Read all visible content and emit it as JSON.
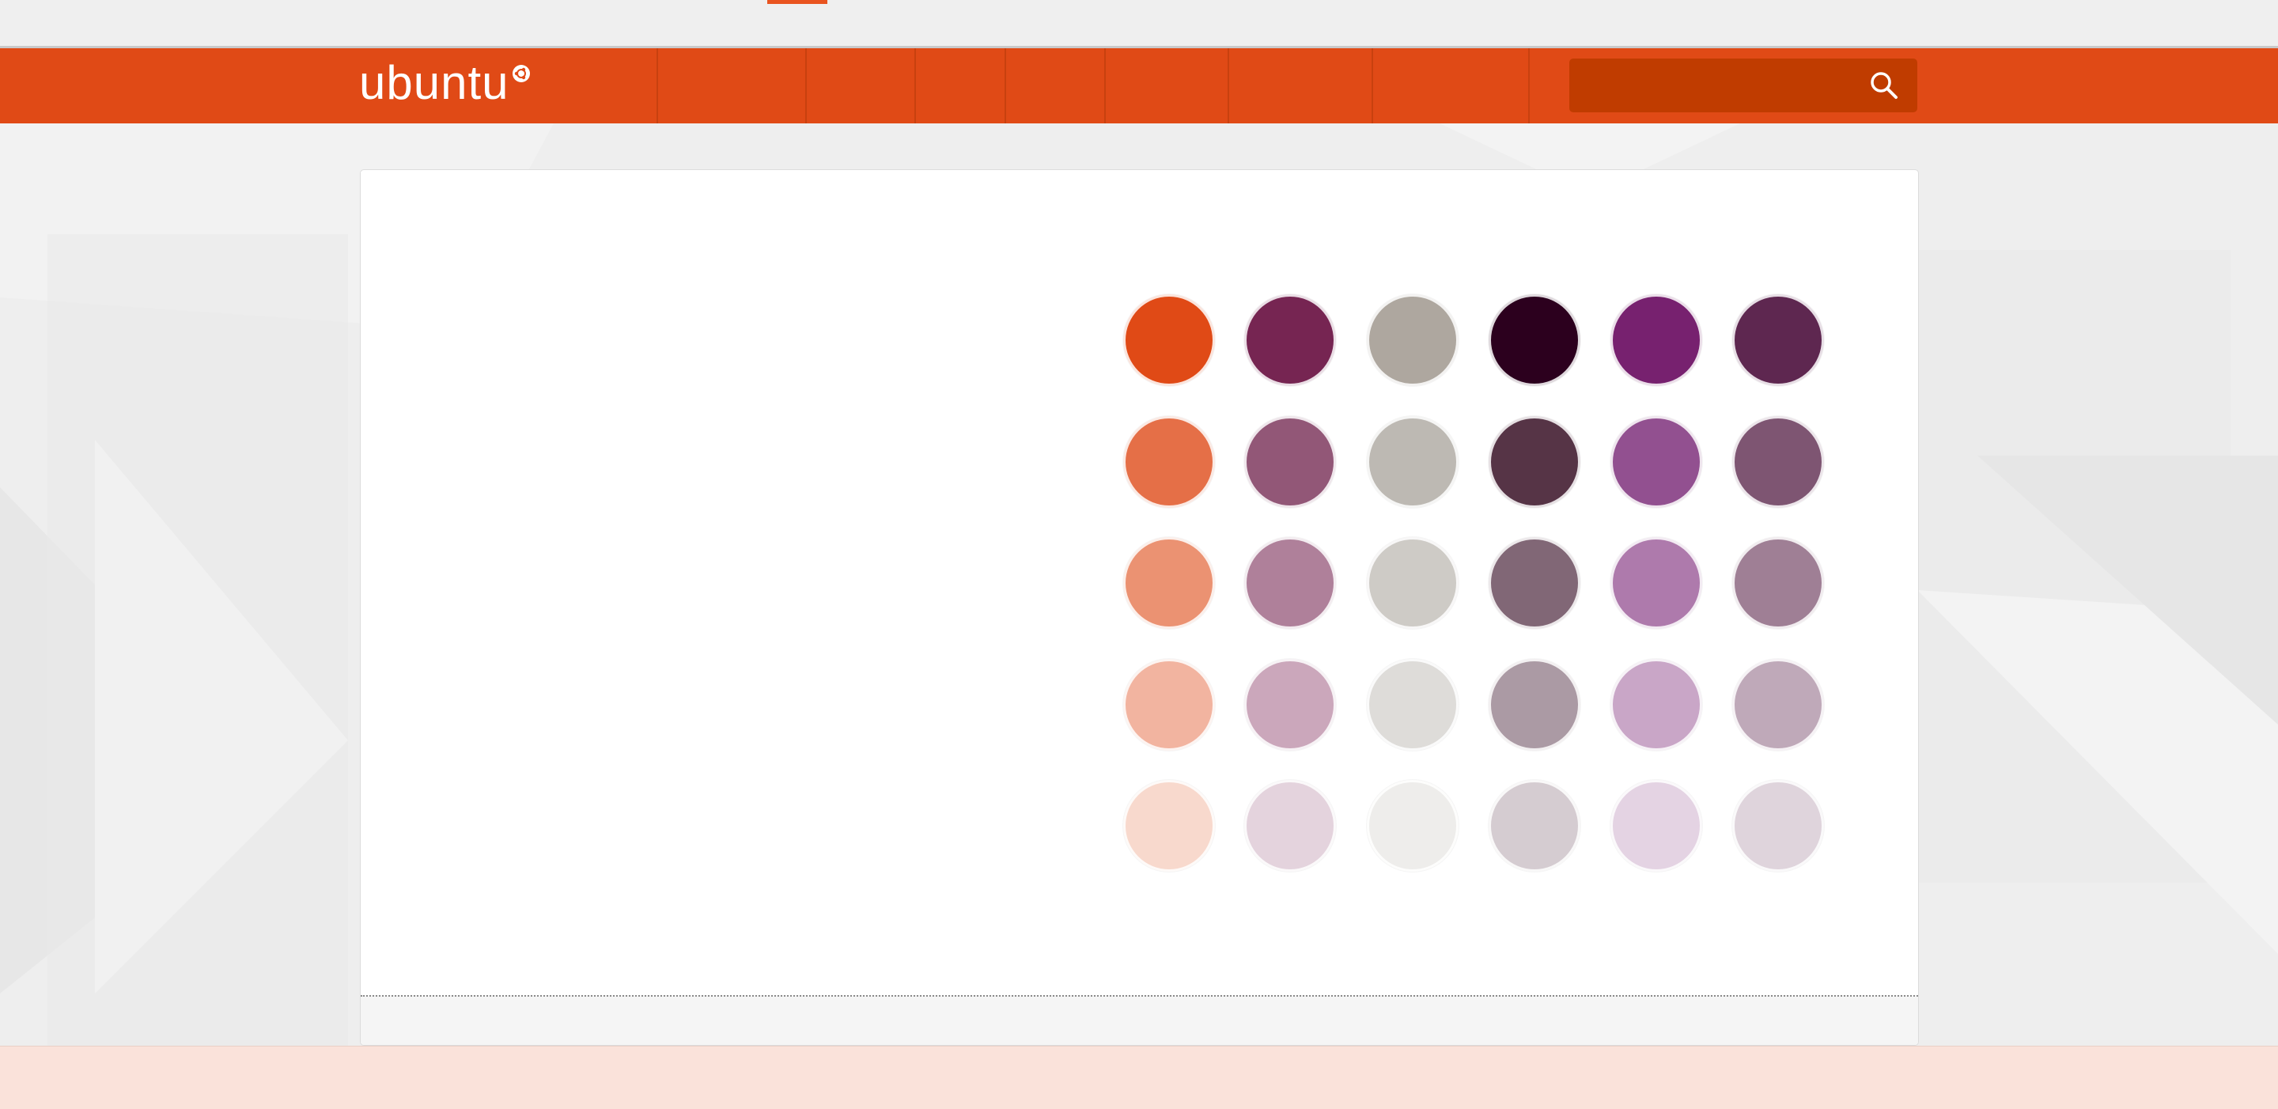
{
  "topbar": {
    "active_color": "#e95420"
  },
  "header": {
    "logo_text": "ubuntu",
    "logo_mark": "circle-of-friends-icon",
    "brand_color": "#e04a16",
    "nav_separator_color": "#c8410f",
    "search": {
      "placeholder": "",
      "value": "",
      "icon": "search-icon",
      "field_color": "#c03c00"
    }
  },
  "palette": {
    "rows": [
      [
        "#e04a16",
        "#762552",
        "#aea79f",
        "#2c001e",
        "#77216f",
        "#5e2750"
      ],
      [
        "#e56f47",
        "#925777",
        "#bdb9b3",
        "#563446",
        "#925090",
        "#7e5572"
      ],
      [
        "#eb9272",
        "#af809a",
        "#cecbc6",
        "#816776",
        "#ae7aac",
        "#9f7f95"
      ],
      [
        "#f2b4a0",
        "#cba7bb",
        "#dedcd9",
        "#ab9aa4",
        "#c9a6c7",
        "#bfa9b9"
      ],
      [
        "#f8d9cd",
        "#e4d3dd",
        "#eeedeb",
        "#d5ccd1",
        "#e4d3e3",
        "#dfd4dc"
      ]
    ]
  },
  "cookie_bar": {
    "background": "#fae2da"
  }
}
